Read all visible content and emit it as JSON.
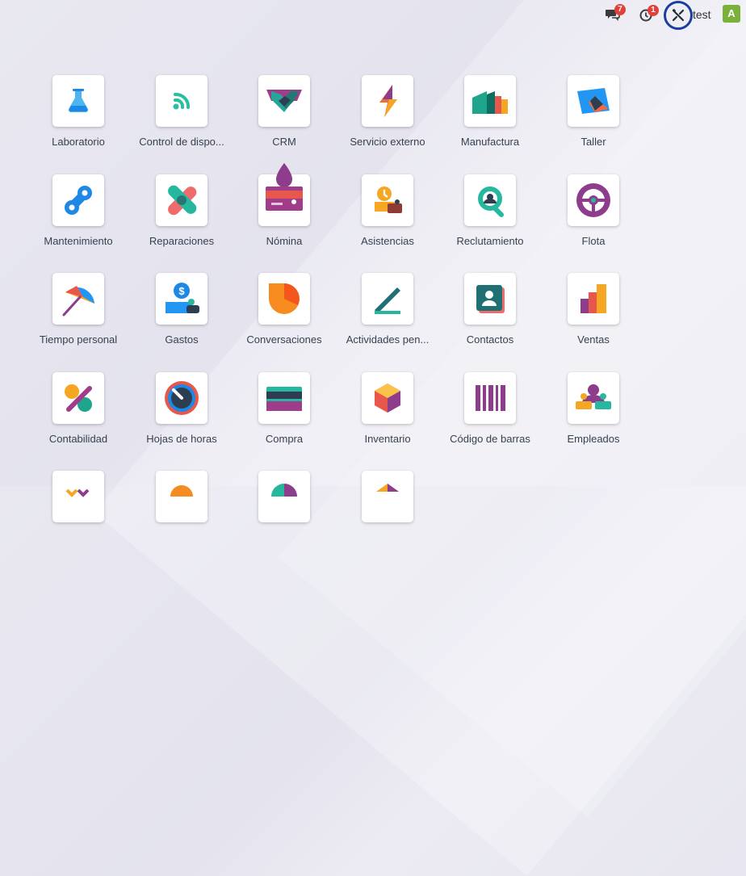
{
  "topbar": {
    "messages_count": "7",
    "activities_count": "1",
    "user_name": "test",
    "avatar_letter": "A"
  },
  "apps": [
    {
      "label": "Laboratorio"
    },
    {
      "label": "Control de dispo..."
    },
    {
      "label": "CRM"
    },
    {
      "label": "Servicio externo"
    },
    {
      "label": "Manufactura"
    },
    {
      "label": "Taller"
    },
    {
      "label": "Mantenimiento"
    },
    {
      "label": "Reparaciones"
    },
    {
      "label": "Nómina"
    },
    {
      "label": "Asistencias"
    },
    {
      "label": "Reclutamiento"
    },
    {
      "label": "Flota"
    },
    {
      "label": "Tiempo personal"
    },
    {
      "label": "Gastos"
    },
    {
      "label": "Conversaciones"
    },
    {
      "label": "Actividades pen..."
    },
    {
      "label": "Contactos"
    },
    {
      "label": "Ventas"
    },
    {
      "label": "Contabilidad"
    },
    {
      "label": "Hojas de horas"
    },
    {
      "label": "Compra"
    },
    {
      "label": "Inventario"
    },
    {
      "label": "Código de barras"
    },
    {
      "label": "Empleados"
    }
  ]
}
